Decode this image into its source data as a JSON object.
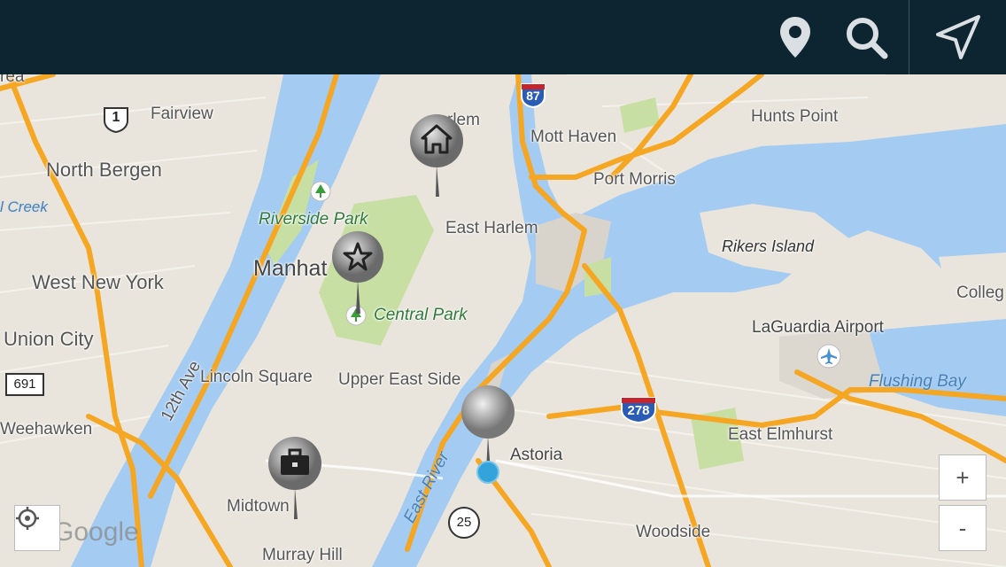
{
  "toolbar": {
    "pin_icon": "map-pin-icon",
    "search_icon": "search-icon",
    "navigate_icon": "navigation-arrow-icon",
    "background": "#0c2530"
  },
  "map": {
    "labels": {
      "fairview": "Fairview",
      "north_bergen": "North Bergen",
      "creek": "l Creek",
      "area": "rea",
      "west_new_york": "West New York",
      "union_city": "Union City",
      "weehawken": "Weehawken",
      "twelfth_ave": "12th Ave",
      "riverside_park": "Riverside Park",
      "manhattan": "Manhat",
      "central_park": "Central Park",
      "lincoln_square": "Lincoln Square",
      "upper_east_side": "Upper East Side",
      "midtown": "Midtown",
      "murray_hill": "Murray Hill",
      "harlem": "rlem",
      "east_harlem": "East Harlem",
      "mott_haven": "Mott Haven",
      "port_morris": "Port Morris",
      "hunts_point": "Hunts Point",
      "rikers_island": "Rikers Island",
      "laguardia": "LaGuardia Airport",
      "flushing_bay": "Flushing Bay",
      "college": "Colleg",
      "east_river": "East River",
      "astoria": "Astoria",
      "east_elmhurst": "East Elmhurst",
      "woodside": "Woodside",
      "google": "Google"
    },
    "shields": {
      "us1": "1",
      "i87": "87",
      "i278": "278",
      "r691": "691",
      "r25": "25"
    },
    "pins": {
      "home": "home-icon",
      "favorite": "star-icon",
      "work": "briefcase-icon"
    },
    "controls": {
      "zoom_in": "+",
      "zoom_out": "-",
      "my_location": "crosshair-icon"
    },
    "colors": {
      "land": "#e9e5dc",
      "water": "#a4cbf2",
      "highway": "#f5a623",
      "park": "#c8dfa4",
      "current_location": "#33a3dc"
    }
  }
}
